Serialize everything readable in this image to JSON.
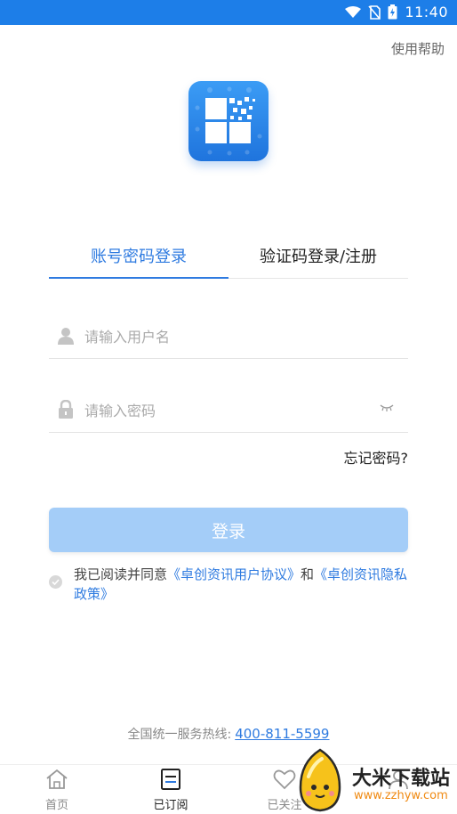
{
  "status_bar": {
    "time": "11:40"
  },
  "header": {
    "help_label": "使用帮助"
  },
  "tabs": [
    {
      "label": "账号密码登录",
      "active": true
    },
    {
      "label": "验证码登录/注册",
      "active": false
    }
  ],
  "form": {
    "username_placeholder": "请输入用户名",
    "password_placeholder": "请输入密码",
    "forgot_label": "忘记密码?",
    "login_label": "登录"
  },
  "agreement": {
    "prefix": "我已阅读并同意",
    "user_agreement": "《卓创资讯用户协议》",
    "and": "和",
    "privacy_policy": "《卓创资讯隐私政策》"
  },
  "hotline": {
    "label": "全国统一服务热线:",
    "number": "400-811-5599"
  },
  "bottom_nav": [
    {
      "label": "首页",
      "icon": "home-icon"
    },
    {
      "label": "已订阅",
      "icon": "subscribe-icon",
      "active": true
    },
    {
      "label": "已关注",
      "icon": "heart-icon"
    },
    {
      "label": "",
      "icon": "user-icon"
    }
  ],
  "watermark": {
    "title": "大米下载站",
    "url": "www.zzhyw.com"
  },
  "colors": {
    "accent": "#2f7be0",
    "status_bar": "#1d7ee8",
    "button_disabled": "#a4cdf8"
  }
}
